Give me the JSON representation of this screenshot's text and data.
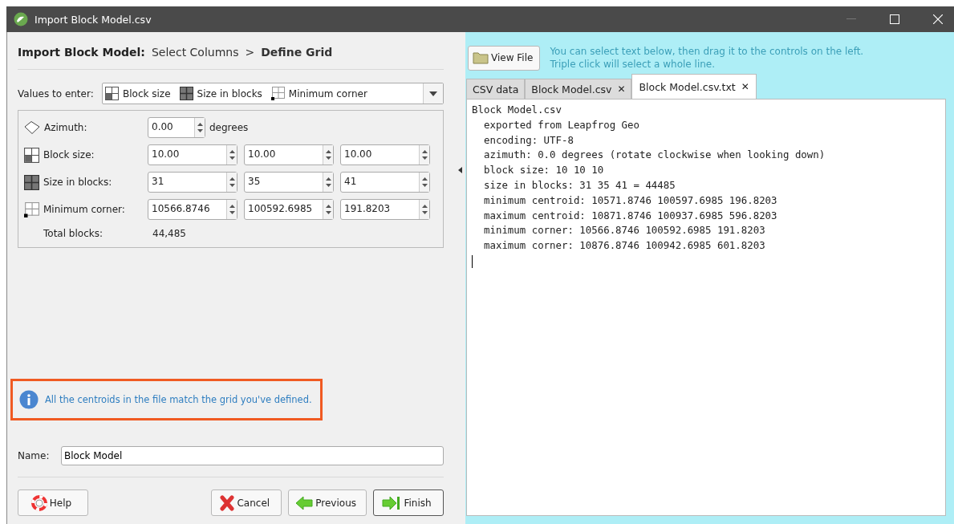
{
  "window": {
    "title": "Import Block Model.csv"
  },
  "wizard": {
    "heading": "Import Block Model:",
    "separator": ">",
    "steps": [
      {
        "label": "Select Columns",
        "selected": false
      },
      {
        "label": "Define Grid",
        "selected": true
      }
    ]
  },
  "values_to_enter": {
    "label": "Values to enter:",
    "options": [
      {
        "label": "Block size",
        "kind": "block-size"
      },
      {
        "label": "Size in blocks",
        "kind": "size-in-blocks"
      },
      {
        "label": "Minimum corner",
        "kind": "minimum-corner"
      }
    ]
  },
  "grid_rows": [
    {
      "kind": "azimuth",
      "label": "Azimuth:",
      "values": [
        "0.00"
      ],
      "unit": "degrees"
    },
    {
      "kind": "block-size",
      "label": "Block size:",
      "values": [
        "10.00",
        "10.00",
        "10.00"
      ]
    },
    {
      "kind": "size-in-blocks",
      "label": "Size in blocks:",
      "values": [
        "31",
        "35",
        "41"
      ]
    },
    {
      "kind": "minimum-corner",
      "label": "Minimum corner:",
      "values": [
        "10566.8746",
        "100592.6985",
        "191.8203"
      ]
    }
  ],
  "total_blocks": {
    "label": "Total blocks:",
    "value": "44,485"
  },
  "message": {
    "text": "All the centroids in the file match the grid you've defined.",
    "highlighted": true
  },
  "name": {
    "label": "Name:",
    "value": "Block Model"
  },
  "buttons": [
    {
      "label": "Help",
      "kind": "help",
      "default": false
    },
    {
      "label": "Cancel",
      "kind": "cancel",
      "default": false
    },
    {
      "label": "Previous",
      "kind": "previous",
      "default": false
    },
    {
      "label": "Finish",
      "kind": "finish",
      "default": true
    }
  ],
  "viewer": {
    "view_file_button": "View File",
    "hint_lines": [
      "You can select text below, then drag it to the controls on the left.",
      "Triple click will select a whole line."
    ],
    "tabs": [
      {
        "label": "CSV data",
        "closable": false,
        "selected": false
      },
      {
        "label": "Block Model.csv",
        "closable": true,
        "selected": false
      },
      {
        "label": "Block Model.csv.txt",
        "closable": true,
        "selected": true
      }
    ],
    "close_glyph": "✕",
    "lines": [
      {
        "text": "Block Model.csv",
        "indented": false
      },
      {
        "text": "exported from Leapfrog Geo",
        "indented": true
      },
      {
        "text": "encoding: UTF-8",
        "indented": true
      },
      {
        "text": "azimuth: 0.0 degrees (rotate clockwise when looking down)",
        "indented": true
      },
      {
        "text": "block size: 10 10 10",
        "indented": true
      },
      {
        "text": "size in blocks: 31 35 41 = 44485",
        "indented": true
      },
      {
        "text": "minimum centroid: 10571.8746 100597.6985 196.8203",
        "indented": true
      },
      {
        "text": "maximum centroid: 10871.8746 100937.6985 596.8203",
        "indented": true
      },
      {
        "text": "minimum corner: 10566.8746 100592.6985 191.8203",
        "indented": true
      },
      {
        "text": "maximum corner: 10876.8746 100942.6985 601.8203",
        "indented": true
      }
    ]
  }
}
